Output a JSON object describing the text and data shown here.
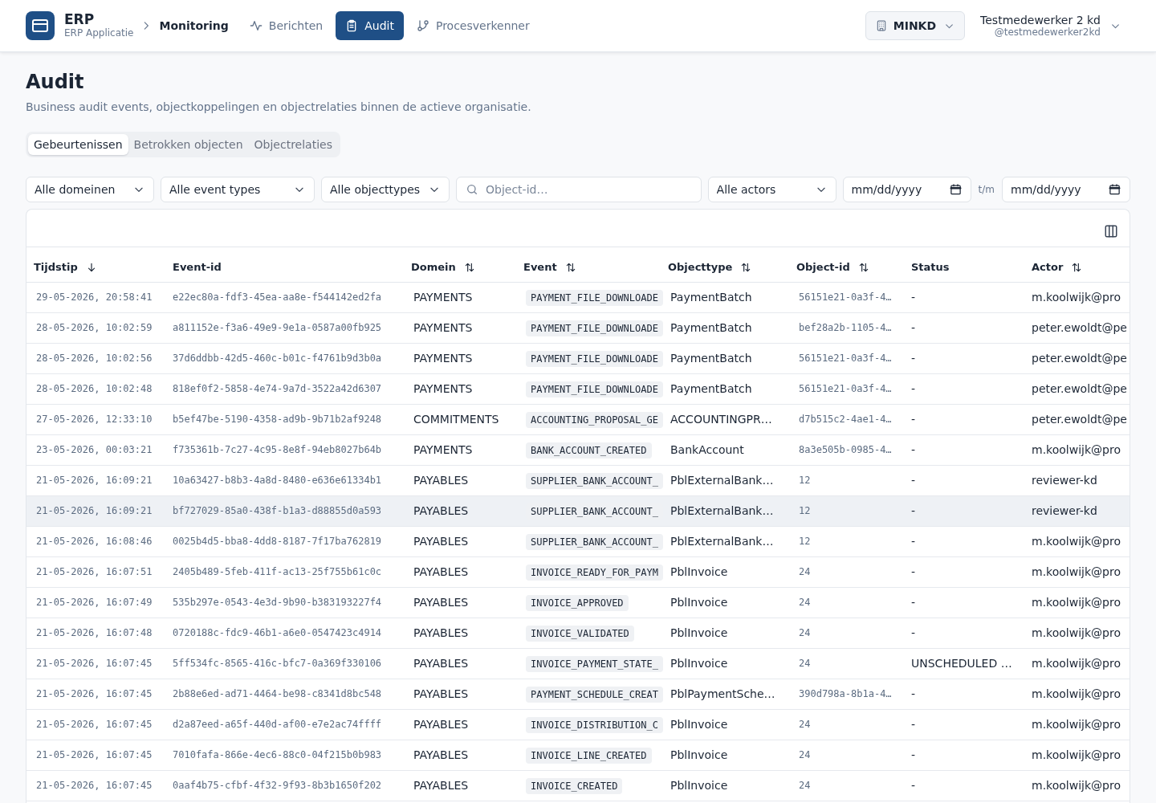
{
  "app": {
    "name": "ERP",
    "subtitle": "ERP Applicatie"
  },
  "breadcrumb": "Monitoring",
  "nav": [
    {
      "label": "Berichten",
      "selected": false
    },
    {
      "label": "Audit",
      "selected": true
    },
    {
      "label": "Procesverkenner",
      "selected": false
    }
  ],
  "organization": {
    "label": "MINKD"
  },
  "user": {
    "name": "Testmedewerker 2 kd",
    "handle": "@testmedewerker2kd"
  },
  "page": {
    "title": "Audit",
    "description": "Business audit events, objectkoppelingen en objectrelaties binnen de actieve organisatie."
  },
  "tabs": [
    {
      "label": "Gebeurtenissen",
      "selected": true
    },
    {
      "label": "Betrokken objecten",
      "selected": false
    },
    {
      "label": "Objectrelaties",
      "selected": false
    }
  ],
  "filters": [
    {
      "kind": "select",
      "value": "Alle domeinen"
    },
    {
      "kind": "select",
      "value": "Alle event types"
    },
    {
      "kind": "select",
      "value": "Alle objecttypes"
    },
    {
      "kind": "search",
      "placeholder": "Object-id…"
    },
    {
      "kind": "select",
      "value": "Alle actors"
    },
    {
      "kind": "date",
      "placeholder": "mm/dd/yyyy"
    },
    {
      "kind": "separator",
      "label": "t/m"
    },
    {
      "kind": "date",
      "placeholder": "mm/dd/yyyy"
    }
  ],
  "table": {
    "columns": [
      {
        "label": "Tijdstip",
        "kind": "descending"
      },
      {
        "label": "Event-id",
        "kind": "plain"
      },
      {
        "label": "Domein",
        "kind": "sortable"
      },
      {
        "label": "Event",
        "kind": "sortable"
      },
      {
        "label": "Objecttype",
        "kind": "sortable"
      },
      {
        "label": "Object-id",
        "kind": "sortable"
      },
      {
        "label": "Status",
        "kind": "plain"
      },
      {
        "label": "Actor",
        "kind": "sortable"
      }
    ],
    "rows": [
      {
        "timestamp": "29-05-2026, 20:58:41",
        "event_id": "e22ec80a-fdf3-45ea-aa8e-f544142ed2fa",
        "domain": "PAYMENTS",
        "event": "PAYMENT_FILE_DOWNLOADE",
        "object_type": "PaymentBatch",
        "object_id": "56151e21-0a3f-4…",
        "status": "-",
        "actor": "m.koolwijk@pro",
        "highlighted": false
      },
      {
        "timestamp": "28-05-2026, 10:02:59",
        "event_id": "a811152e-f3a6-49e9-9e1a-0587a00fb925",
        "domain": "PAYMENTS",
        "event": "PAYMENT_FILE_DOWNLOADE",
        "object_type": "PaymentBatch",
        "object_id": "bef28a2b-1105-4…",
        "status": "-",
        "actor": "peter.ewoldt@pe",
        "highlighted": false
      },
      {
        "timestamp": "28-05-2026, 10:02:56",
        "event_id": "37d6ddbb-42d5-460c-b01c-f4761b9d3b0a",
        "domain": "PAYMENTS",
        "event": "PAYMENT_FILE_DOWNLOADE",
        "object_type": "PaymentBatch",
        "object_id": "56151e21-0a3f-4…",
        "status": "-",
        "actor": "peter.ewoldt@pe",
        "highlighted": false
      },
      {
        "timestamp": "28-05-2026, 10:02:48",
        "event_id": "818ef0f2-5858-4e74-9a7d-3522a42d6307",
        "domain": "PAYMENTS",
        "event": "PAYMENT_FILE_DOWNLOADE",
        "object_type": "PaymentBatch",
        "object_id": "56151e21-0a3f-4…",
        "status": "-",
        "actor": "peter.ewoldt@pe",
        "highlighted": false
      },
      {
        "timestamp": "27-05-2026, 12:33:10",
        "event_id": "b5ef47be-5190-4358-ad9b-9b71b2af9248",
        "domain": "COMMITMENTS",
        "event": "ACCOUNTING_PROPOSAL_GE",
        "object_type": "ACCOUNTINGPR…",
        "object_id": "d7b515c2-4ae1-4…",
        "status": "-",
        "actor": "peter.ewoldt@pe",
        "highlighted": false
      },
      {
        "timestamp": "23-05-2026, 00:03:21",
        "event_id": "f735361b-7c27-4c95-8e8f-94eb8027b64b",
        "domain": "PAYMENTS",
        "event": "BANK_ACCOUNT_CREATED",
        "object_type": "BankAccount",
        "object_id": "8a3e505b-0985-4…",
        "status": "-",
        "actor": "m.koolwijk@pro",
        "highlighted": false
      },
      {
        "timestamp": "21-05-2026, 16:09:21",
        "event_id": "10a63427-b8b3-4a8d-8480-e636e61334b1",
        "domain": "PAYABLES",
        "event": "SUPPLIER_BANK_ACCOUNT_",
        "object_type": "PblExternalBank…",
        "object_id": "12",
        "status": "-",
        "actor": "reviewer-kd",
        "highlighted": false
      },
      {
        "timestamp": "21-05-2026, 16:09:21",
        "event_id": "bf727029-85a0-438f-b1a3-d88855d0a593",
        "domain": "PAYABLES",
        "event": "SUPPLIER_BANK_ACCOUNT_",
        "object_type": "PblExternalBank…",
        "object_id": "12",
        "status": "-",
        "actor": "reviewer-kd",
        "highlighted": true
      },
      {
        "timestamp": "21-05-2026, 16:08:46",
        "event_id": "0025b4d5-bba8-4dd8-8187-7f17ba762819",
        "domain": "PAYABLES",
        "event": "SUPPLIER_BANK_ACCOUNT_",
        "object_type": "PblExternalBank…",
        "object_id": "12",
        "status": "-",
        "actor": "m.koolwijk@pro",
        "highlighted": false
      },
      {
        "timestamp": "21-05-2026, 16:07:51",
        "event_id": "2405b489-5feb-411f-ac13-25f755b61c0c",
        "domain": "PAYABLES",
        "event": "INVOICE_READY_FOR_PAYM",
        "object_type": "PblInvoice",
        "object_id": "24",
        "status": "-",
        "actor": "m.koolwijk@pro",
        "highlighted": false
      },
      {
        "timestamp": "21-05-2026, 16:07:49",
        "event_id": "535b297e-0543-4e3d-9b90-b383193227f4",
        "domain": "PAYABLES",
        "event": "INVOICE_APPROVED",
        "object_type": "PblInvoice",
        "object_id": "24",
        "status": "-",
        "actor": "m.koolwijk@pro",
        "highlighted": false
      },
      {
        "timestamp": "21-05-2026, 16:07:48",
        "event_id": "0720188c-fdc9-46b1-a6e0-0547423c4914",
        "domain": "PAYABLES",
        "event": "INVOICE_VALIDATED",
        "object_type": "PblInvoice",
        "object_id": "24",
        "status": "-",
        "actor": "m.koolwijk@pro",
        "highlighted": false
      },
      {
        "timestamp": "21-05-2026, 16:07:45",
        "event_id": "5ff534fc-8565-416c-bfc7-0a369f330106",
        "domain": "PAYABLES",
        "event": "INVOICE_PAYMENT_STATE_",
        "object_type": "PblInvoice",
        "object_id": "24",
        "status": "UNSCHEDULED …",
        "actor": "m.koolwijk@pro",
        "highlighted": false
      },
      {
        "timestamp": "21-05-2026, 16:07:45",
        "event_id": "2b88e6ed-ad71-4464-be98-c8341d8bc548",
        "domain": "PAYABLES",
        "event": "PAYMENT_SCHEDULE_CREAT",
        "object_type": "PblPaymentSche…",
        "object_id": "390d798a-8b1a-4…",
        "status": "-",
        "actor": "m.koolwijk@pro",
        "highlighted": false
      },
      {
        "timestamp": "21-05-2026, 16:07:45",
        "event_id": "d2a87eed-a65f-440d-af00-e7e2ac74ffff",
        "domain": "PAYABLES",
        "event": "INVOICE_DISTRIBUTION_C",
        "object_type": "PblInvoice",
        "object_id": "24",
        "status": "-",
        "actor": "m.koolwijk@pro",
        "highlighted": false
      },
      {
        "timestamp": "21-05-2026, 16:07:45",
        "event_id": "7010fafa-866e-4ec6-88c0-04f215b0b983",
        "domain": "PAYABLES",
        "event": "INVOICE_LINE_CREATED",
        "object_type": "PblInvoice",
        "object_id": "24",
        "status": "-",
        "actor": "m.koolwijk@pro",
        "highlighted": false
      },
      {
        "timestamp": "21-05-2026, 16:07:45",
        "event_id": "0aaf4b75-cfbf-4f32-9f93-8b3b1650f202",
        "domain": "PAYABLES",
        "event": "INVOICE_CREATED",
        "object_type": "PblInvoice",
        "object_id": "24",
        "status": "-",
        "actor": "m.koolwijk@pro",
        "highlighted": false
      }
    ]
  }
}
